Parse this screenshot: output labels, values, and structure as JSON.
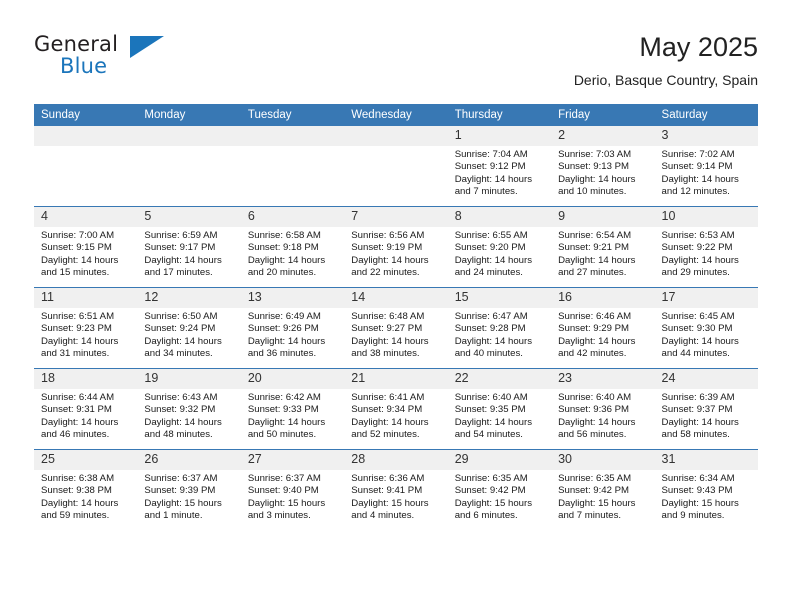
{
  "brand": {
    "name_part1": "General",
    "name_part2": "Blue",
    "triangle_color": "#1b75bb"
  },
  "header": {
    "title": "May 2025",
    "subtitle": "Derio, Basque Country, Spain"
  },
  "theme": {
    "header_blue": "#3878b4",
    "daynum_band": "#f0f0f0",
    "page_bg": "#ffffff"
  },
  "weekday_headers": [
    "Sunday",
    "Monday",
    "Tuesday",
    "Wednesday",
    "Thursday",
    "Friday",
    "Saturday"
  ],
  "weeks": [
    [
      {
        "day": "",
        "sunrise": "",
        "sunset": "",
        "daylight_line1": "",
        "daylight_line2": ""
      },
      {
        "day": "",
        "sunrise": "",
        "sunset": "",
        "daylight_line1": "",
        "daylight_line2": ""
      },
      {
        "day": "",
        "sunrise": "",
        "sunset": "",
        "daylight_line1": "",
        "daylight_line2": ""
      },
      {
        "day": "",
        "sunrise": "",
        "sunset": "",
        "daylight_line1": "",
        "daylight_line2": ""
      },
      {
        "day": "1",
        "sunrise": "Sunrise: 7:04 AM",
        "sunset": "Sunset: 9:12 PM",
        "daylight_line1": "Daylight: 14 hours",
        "daylight_line2": "and 7 minutes."
      },
      {
        "day": "2",
        "sunrise": "Sunrise: 7:03 AM",
        "sunset": "Sunset: 9:13 PM",
        "daylight_line1": "Daylight: 14 hours",
        "daylight_line2": "and 10 minutes."
      },
      {
        "day": "3",
        "sunrise": "Sunrise: 7:02 AM",
        "sunset": "Sunset: 9:14 PM",
        "daylight_line1": "Daylight: 14 hours",
        "daylight_line2": "and 12 minutes."
      }
    ],
    [
      {
        "day": "4",
        "sunrise": "Sunrise: 7:00 AM",
        "sunset": "Sunset: 9:15 PM",
        "daylight_line1": "Daylight: 14 hours",
        "daylight_line2": "and 15 minutes."
      },
      {
        "day": "5",
        "sunrise": "Sunrise: 6:59 AM",
        "sunset": "Sunset: 9:17 PM",
        "daylight_line1": "Daylight: 14 hours",
        "daylight_line2": "and 17 minutes."
      },
      {
        "day": "6",
        "sunrise": "Sunrise: 6:58 AM",
        "sunset": "Sunset: 9:18 PM",
        "daylight_line1": "Daylight: 14 hours",
        "daylight_line2": "and 20 minutes."
      },
      {
        "day": "7",
        "sunrise": "Sunrise: 6:56 AM",
        "sunset": "Sunset: 9:19 PM",
        "daylight_line1": "Daylight: 14 hours",
        "daylight_line2": "and 22 minutes."
      },
      {
        "day": "8",
        "sunrise": "Sunrise: 6:55 AM",
        "sunset": "Sunset: 9:20 PM",
        "daylight_line1": "Daylight: 14 hours",
        "daylight_line2": "and 24 minutes."
      },
      {
        "day": "9",
        "sunrise": "Sunrise: 6:54 AM",
        "sunset": "Sunset: 9:21 PM",
        "daylight_line1": "Daylight: 14 hours",
        "daylight_line2": "and 27 minutes."
      },
      {
        "day": "10",
        "sunrise": "Sunrise: 6:53 AM",
        "sunset": "Sunset: 9:22 PM",
        "daylight_line1": "Daylight: 14 hours",
        "daylight_line2": "and 29 minutes."
      }
    ],
    [
      {
        "day": "11",
        "sunrise": "Sunrise: 6:51 AM",
        "sunset": "Sunset: 9:23 PM",
        "daylight_line1": "Daylight: 14 hours",
        "daylight_line2": "and 31 minutes."
      },
      {
        "day": "12",
        "sunrise": "Sunrise: 6:50 AM",
        "sunset": "Sunset: 9:24 PM",
        "daylight_line1": "Daylight: 14 hours",
        "daylight_line2": "and 34 minutes."
      },
      {
        "day": "13",
        "sunrise": "Sunrise: 6:49 AM",
        "sunset": "Sunset: 9:26 PM",
        "daylight_line1": "Daylight: 14 hours",
        "daylight_line2": "and 36 minutes."
      },
      {
        "day": "14",
        "sunrise": "Sunrise: 6:48 AM",
        "sunset": "Sunset: 9:27 PM",
        "daylight_line1": "Daylight: 14 hours",
        "daylight_line2": "and 38 minutes."
      },
      {
        "day": "15",
        "sunrise": "Sunrise: 6:47 AM",
        "sunset": "Sunset: 9:28 PM",
        "daylight_line1": "Daylight: 14 hours",
        "daylight_line2": "and 40 minutes."
      },
      {
        "day": "16",
        "sunrise": "Sunrise: 6:46 AM",
        "sunset": "Sunset: 9:29 PM",
        "daylight_line1": "Daylight: 14 hours",
        "daylight_line2": "and 42 minutes."
      },
      {
        "day": "17",
        "sunrise": "Sunrise: 6:45 AM",
        "sunset": "Sunset: 9:30 PM",
        "daylight_line1": "Daylight: 14 hours",
        "daylight_line2": "and 44 minutes."
      }
    ],
    [
      {
        "day": "18",
        "sunrise": "Sunrise: 6:44 AM",
        "sunset": "Sunset: 9:31 PM",
        "daylight_line1": "Daylight: 14 hours",
        "daylight_line2": "and 46 minutes."
      },
      {
        "day": "19",
        "sunrise": "Sunrise: 6:43 AM",
        "sunset": "Sunset: 9:32 PM",
        "daylight_line1": "Daylight: 14 hours",
        "daylight_line2": "and 48 minutes."
      },
      {
        "day": "20",
        "sunrise": "Sunrise: 6:42 AM",
        "sunset": "Sunset: 9:33 PM",
        "daylight_line1": "Daylight: 14 hours",
        "daylight_line2": "and 50 minutes."
      },
      {
        "day": "21",
        "sunrise": "Sunrise: 6:41 AM",
        "sunset": "Sunset: 9:34 PM",
        "daylight_line1": "Daylight: 14 hours",
        "daylight_line2": "and 52 minutes."
      },
      {
        "day": "22",
        "sunrise": "Sunrise: 6:40 AM",
        "sunset": "Sunset: 9:35 PM",
        "daylight_line1": "Daylight: 14 hours",
        "daylight_line2": "and 54 minutes."
      },
      {
        "day": "23",
        "sunrise": "Sunrise: 6:40 AM",
        "sunset": "Sunset: 9:36 PM",
        "daylight_line1": "Daylight: 14 hours",
        "daylight_line2": "and 56 minutes."
      },
      {
        "day": "24",
        "sunrise": "Sunrise: 6:39 AM",
        "sunset": "Sunset: 9:37 PM",
        "daylight_line1": "Daylight: 14 hours",
        "daylight_line2": "and 58 minutes."
      }
    ],
    [
      {
        "day": "25",
        "sunrise": "Sunrise: 6:38 AM",
        "sunset": "Sunset: 9:38 PM",
        "daylight_line1": "Daylight: 14 hours",
        "daylight_line2": "and 59 minutes."
      },
      {
        "day": "26",
        "sunrise": "Sunrise: 6:37 AM",
        "sunset": "Sunset: 9:39 PM",
        "daylight_line1": "Daylight: 15 hours",
        "daylight_line2": "and 1 minute."
      },
      {
        "day": "27",
        "sunrise": "Sunrise: 6:37 AM",
        "sunset": "Sunset: 9:40 PM",
        "daylight_line1": "Daylight: 15 hours",
        "daylight_line2": "and 3 minutes."
      },
      {
        "day": "28",
        "sunrise": "Sunrise: 6:36 AM",
        "sunset": "Sunset: 9:41 PM",
        "daylight_line1": "Daylight: 15 hours",
        "daylight_line2": "and 4 minutes."
      },
      {
        "day": "29",
        "sunrise": "Sunrise: 6:35 AM",
        "sunset": "Sunset: 9:42 PM",
        "daylight_line1": "Daylight: 15 hours",
        "daylight_line2": "and 6 minutes."
      },
      {
        "day": "30",
        "sunrise": "Sunrise: 6:35 AM",
        "sunset": "Sunset: 9:42 PM",
        "daylight_line1": "Daylight: 15 hours",
        "daylight_line2": "and 7 minutes."
      },
      {
        "day": "31",
        "sunrise": "Sunrise: 6:34 AM",
        "sunset": "Sunset: 9:43 PM",
        "daylight_line1": "Daylight: 15 hours",
        "daylight_line2": "and 9 minutes."
      }
    ]
  ]
}
